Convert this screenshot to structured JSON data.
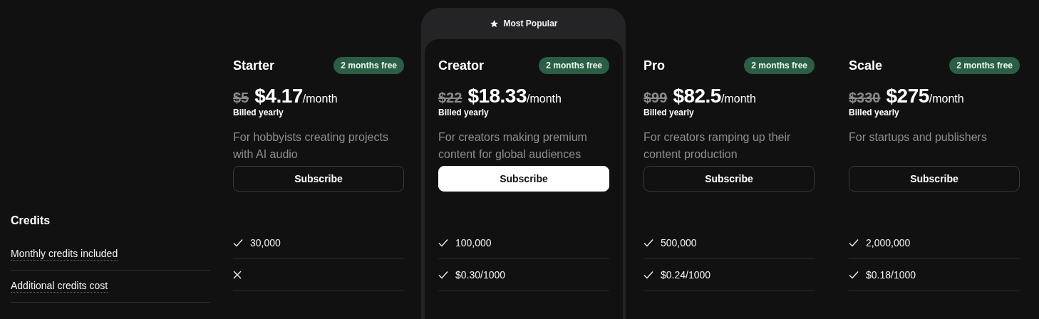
{
  "feature_section": {
    "title": "Credits",
    "rows": [
      "Monthly credits included",
      "Additional credits cost"
    ]
  },
  "plans": [
    {
      "name": "Starter",
      "badge": "2 months free",
      "old_price": "$5",
      "price": "$4.17",
      "period": "/month",
      "billing": "Billed yearly",
      "description": "For hobbyists creating projects with AI audio",
      "button": "Subscribe",
      "popular": false,
      "features": [
        {
          "kind": "check",
          "text": "30,000"
        },
        {
          "kind": "cross"
        }
      ]
    },
    {
      "name": "Creator",
      "ribbon": "Most Popular",
      "badge": "2 months free",
      "old_price": "$22",
      "price": "$18.33",
      "period": "/month",
      "billing": "Billed yearly",
      "description": "For creators making premium content for global audiences",
      "button": "Subscribe",
      "popular": true,
      "features": [
        {
          "kind": "check",
          "text": "100,000"
        },
        {
          "kind": "check",
          "text": "$0.30/1000"
        }
      ]
    },
    {
      "name": "Pro",
      "badge": "2 months free",
      "old_price": "$99",
      "price": "$82.5",
      "period": "/month",
      "billing": "Billed yearly",
      "description": "For creators ramping up their content production",
      "button": "Subscribe",
      "popular": false,
      "features": [
        {
          "kind": "check",
          "text": "500,000"
        },
        {
          "kind": "check",
          "text": "$0.24/1000"
        }
      ]
    },
    {
      "name": "Scale",
      "badge": "2 months free",
      "old_price": "$330",
      "price": "$275",
      "period": "/month",
      "billing": "Billed yearly",
      "description": "For startups and publishers",
      "button": "Subscribe",
      "popular": false,
      "features": [
        {
          "kind": "check",
          "text": "2,000,000"
        },
        {
          "kind": "check",
          "text": "$0.18/1000"
        }
      ]
    }
  ]
}
